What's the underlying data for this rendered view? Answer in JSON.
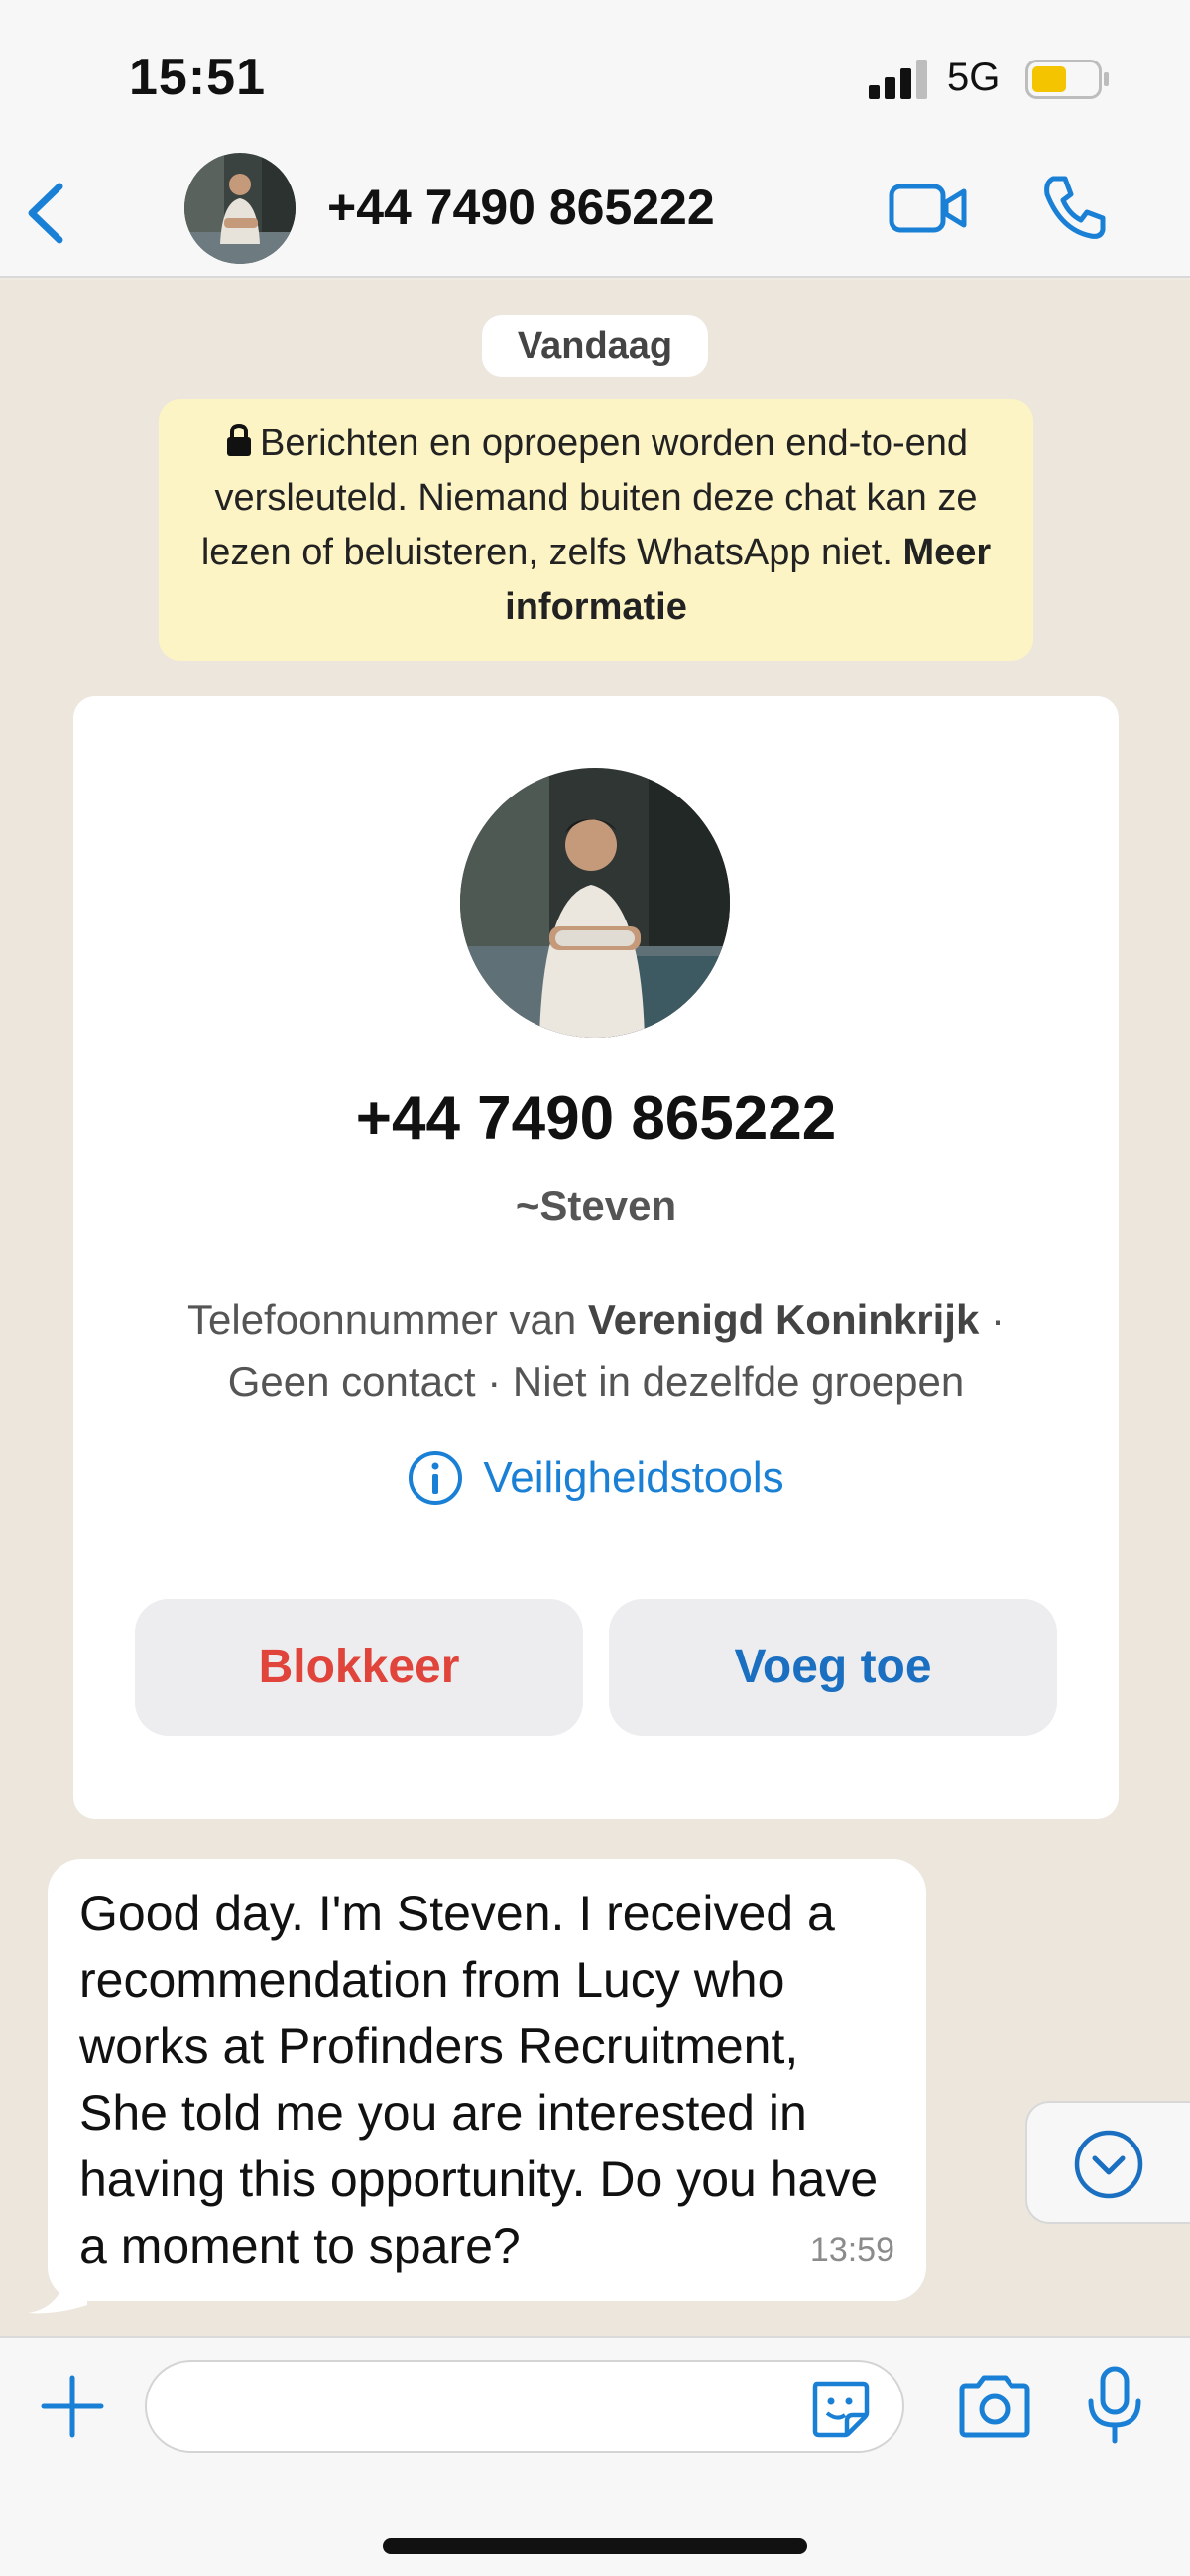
{
  "status_bar": {
    "time": "15:51",
    "network": "5G",
    "signal_bars_filled": 3,
    "signal_bars_total": 4,
    "battery_level": 0.45,
    "battery_color": "#f5c400"
  },
  "header": {
    "title": "+44 7490 865222",
    "icons": [
      "back-chevron-icon",
      "video-call-icon",
      "phone-call-icon"
    ],
    "accent_color": "#1a80d6"
  },
  "chat": {
    "date_label": "Vandaag",
    "encryption_notice": {
      "text": "Berichten en oproepen worden end-to-end versleuteld. Niemand buiten deze chat kan ze lezen of beluisteren, zelfs WhatsApp niet.",
      "link": "Meer informatie"
    },
    "contact_card": {
      "phone": "+44 7490 865222",
      "name": "~Steven",
      "meta_prefix": "Telefoonnummer van",
      "country": "Verenigd Koninkrijk",
      "meta_rest": "Geen contact · Niet in dezelfde groepen",
      "separator": "·",
      "safety_tools": "Veiligheidstools",
      "block_label": "Blokkeer",
      "add_label": "Voeg toe"
    },
    "messages": [
      {
        "text": "Good day. I'm Steven. I received a recommendation from Lucy who works at Profinders Recruitment, She told me you are interested in having this opportunity. Do you have a moment to spare?",
        "time": "13:59",
        "direction": "incoming"
      }
    ]
  },
  "input_bar": {
    "placeholder": "",
    "icons": [
      "plus-icon",
      "sticker-icon",
      "camera-icon",
      "microphone-icon"
    ]
  }
}
